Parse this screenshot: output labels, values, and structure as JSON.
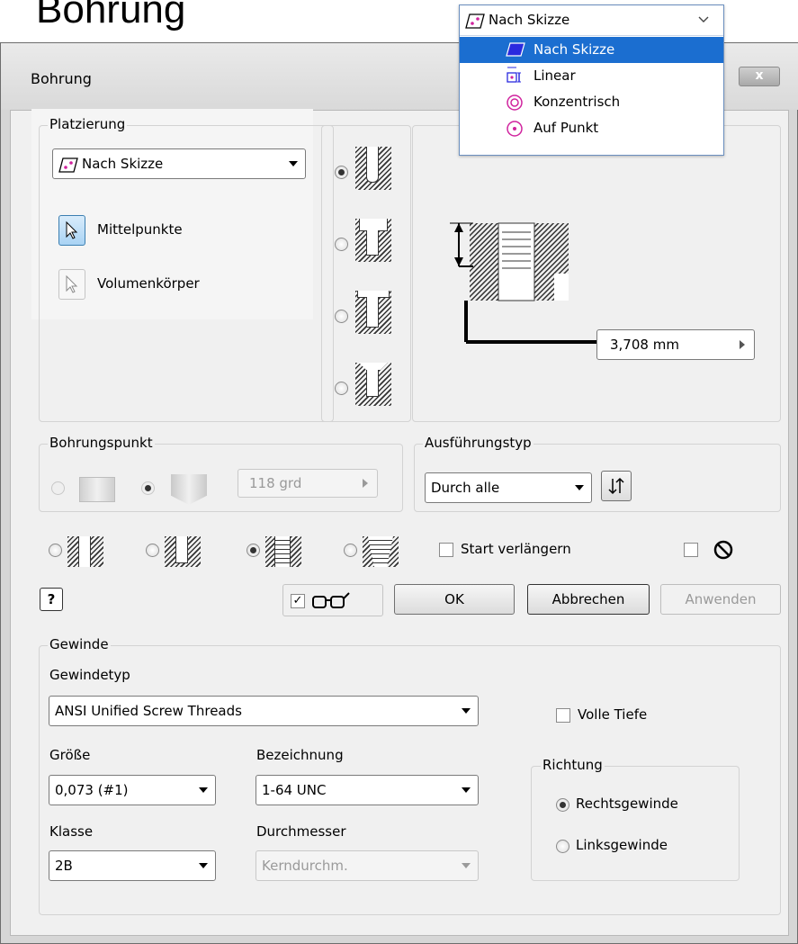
{
  "page_title": "Bohrung",
  "window": {
    "title": "Bohrung",
    "close_label": "x"
  },
  "placement_popup": {
    "selected": "Nach Skizze",
    "items": [
      {
        "label": "Nach Skizze",
        "icon": "sketch-icon",
        "selected": true
      },
      {
        "label": "Linear",
        "icon": "linear-icon"
      },
      {
        "label": "Konzentrisch",
        "icon": "concentric-icon"
      },
      {
        "label": "Auf Punkt",
        "icon": "on-point-icon"
      }
    ]
  },
  "platzierung": {
    "legend": "Platzierung",
    "mode_value": "Nach Skizze",
    "mittelpunkte_label": "Mittelpunkte",
    "volumenkoerper_label": "Volumenkörper"
  },
  "preview": {
    "depth_value": "3,708 mm",
    "partial_label": "Volumenkörper"
  },
  "bohrungspunkt": {
    "legend": "Bohrungspunkt",
    "angle_value": "118 grd"
  },
  "ausfuehrungstyp": {
    "legend": "Ausführungstyp",
    "value": "Durch alle"
  },
  "options": {
    "start_verlaengern_label": "Start verlängern"
  },
  "buttons": {
    "ok": "OK",
    "abbrechen": "Abbrechen",
    "anwenden": "Anwenden",
    "help": "?"
  },
  "gewinde": {
    "legend": "Gewinde",
    "gewindetyp_label": "Gewindetyp",
    "gewindetyp_value": "ANSI Unified Screw Threads",
    "volle_tiefe_label": "Volle Tiefe",
    "groesse_label": "Größe",
    "groesse_value": "0,073 (#1)",
    "bezeichnung_label": "Bezeichnung",
    "bezeichnung_value": "1-64 UNC",
    "klasse_label": "Klasse",
    "klasse_value": "2B",
    "durchmesser_label": "Durchmesser",
    "durchmesser_value": "Kerndurchm.",
    "richtung_legend": "Richtung",
    "rechts_label": "Rechtsgewinde",
    "links_label": "Linksgewinde"
  },
  "colors": {
    "selection_blue": "#1b6ed0",
    "pink": "#d0239e",
    "dialog_bg": "#f0f0f0"
  }
}
